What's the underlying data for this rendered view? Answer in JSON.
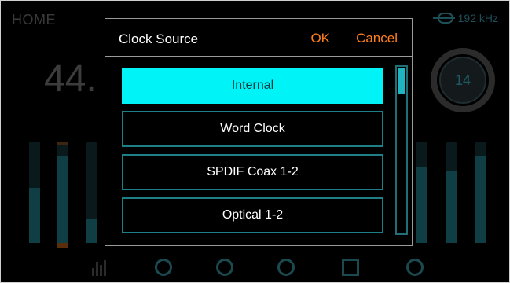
{
  "background": {
    "screen_title": "HOME",
    "sample_rate": "192 kHz",
    "frequency_readout": "44.",
    "knob_value": "14"
  },
  "dialog": {
    "title": "Clock Source",
    "ok_label": "OK",
    "cancel_label": "Cancel",
    "options": [
      {
        "label": "Internal",
        "selected": true
      },
      {
        "label": "Word Clock",
        "selected": false
      },
      {
        "label": "SPDIF Coax 1-2",
        "selected": false
      },
      {
        "label": "Optical 1-2",
        "selected": false
      }
    ]
  },
  "colors": {
    "accent_cyan": "#00f4f7",
    "action_orange": "#ff7f1e",
    "option_border": "#1f7f86"
  }
}
